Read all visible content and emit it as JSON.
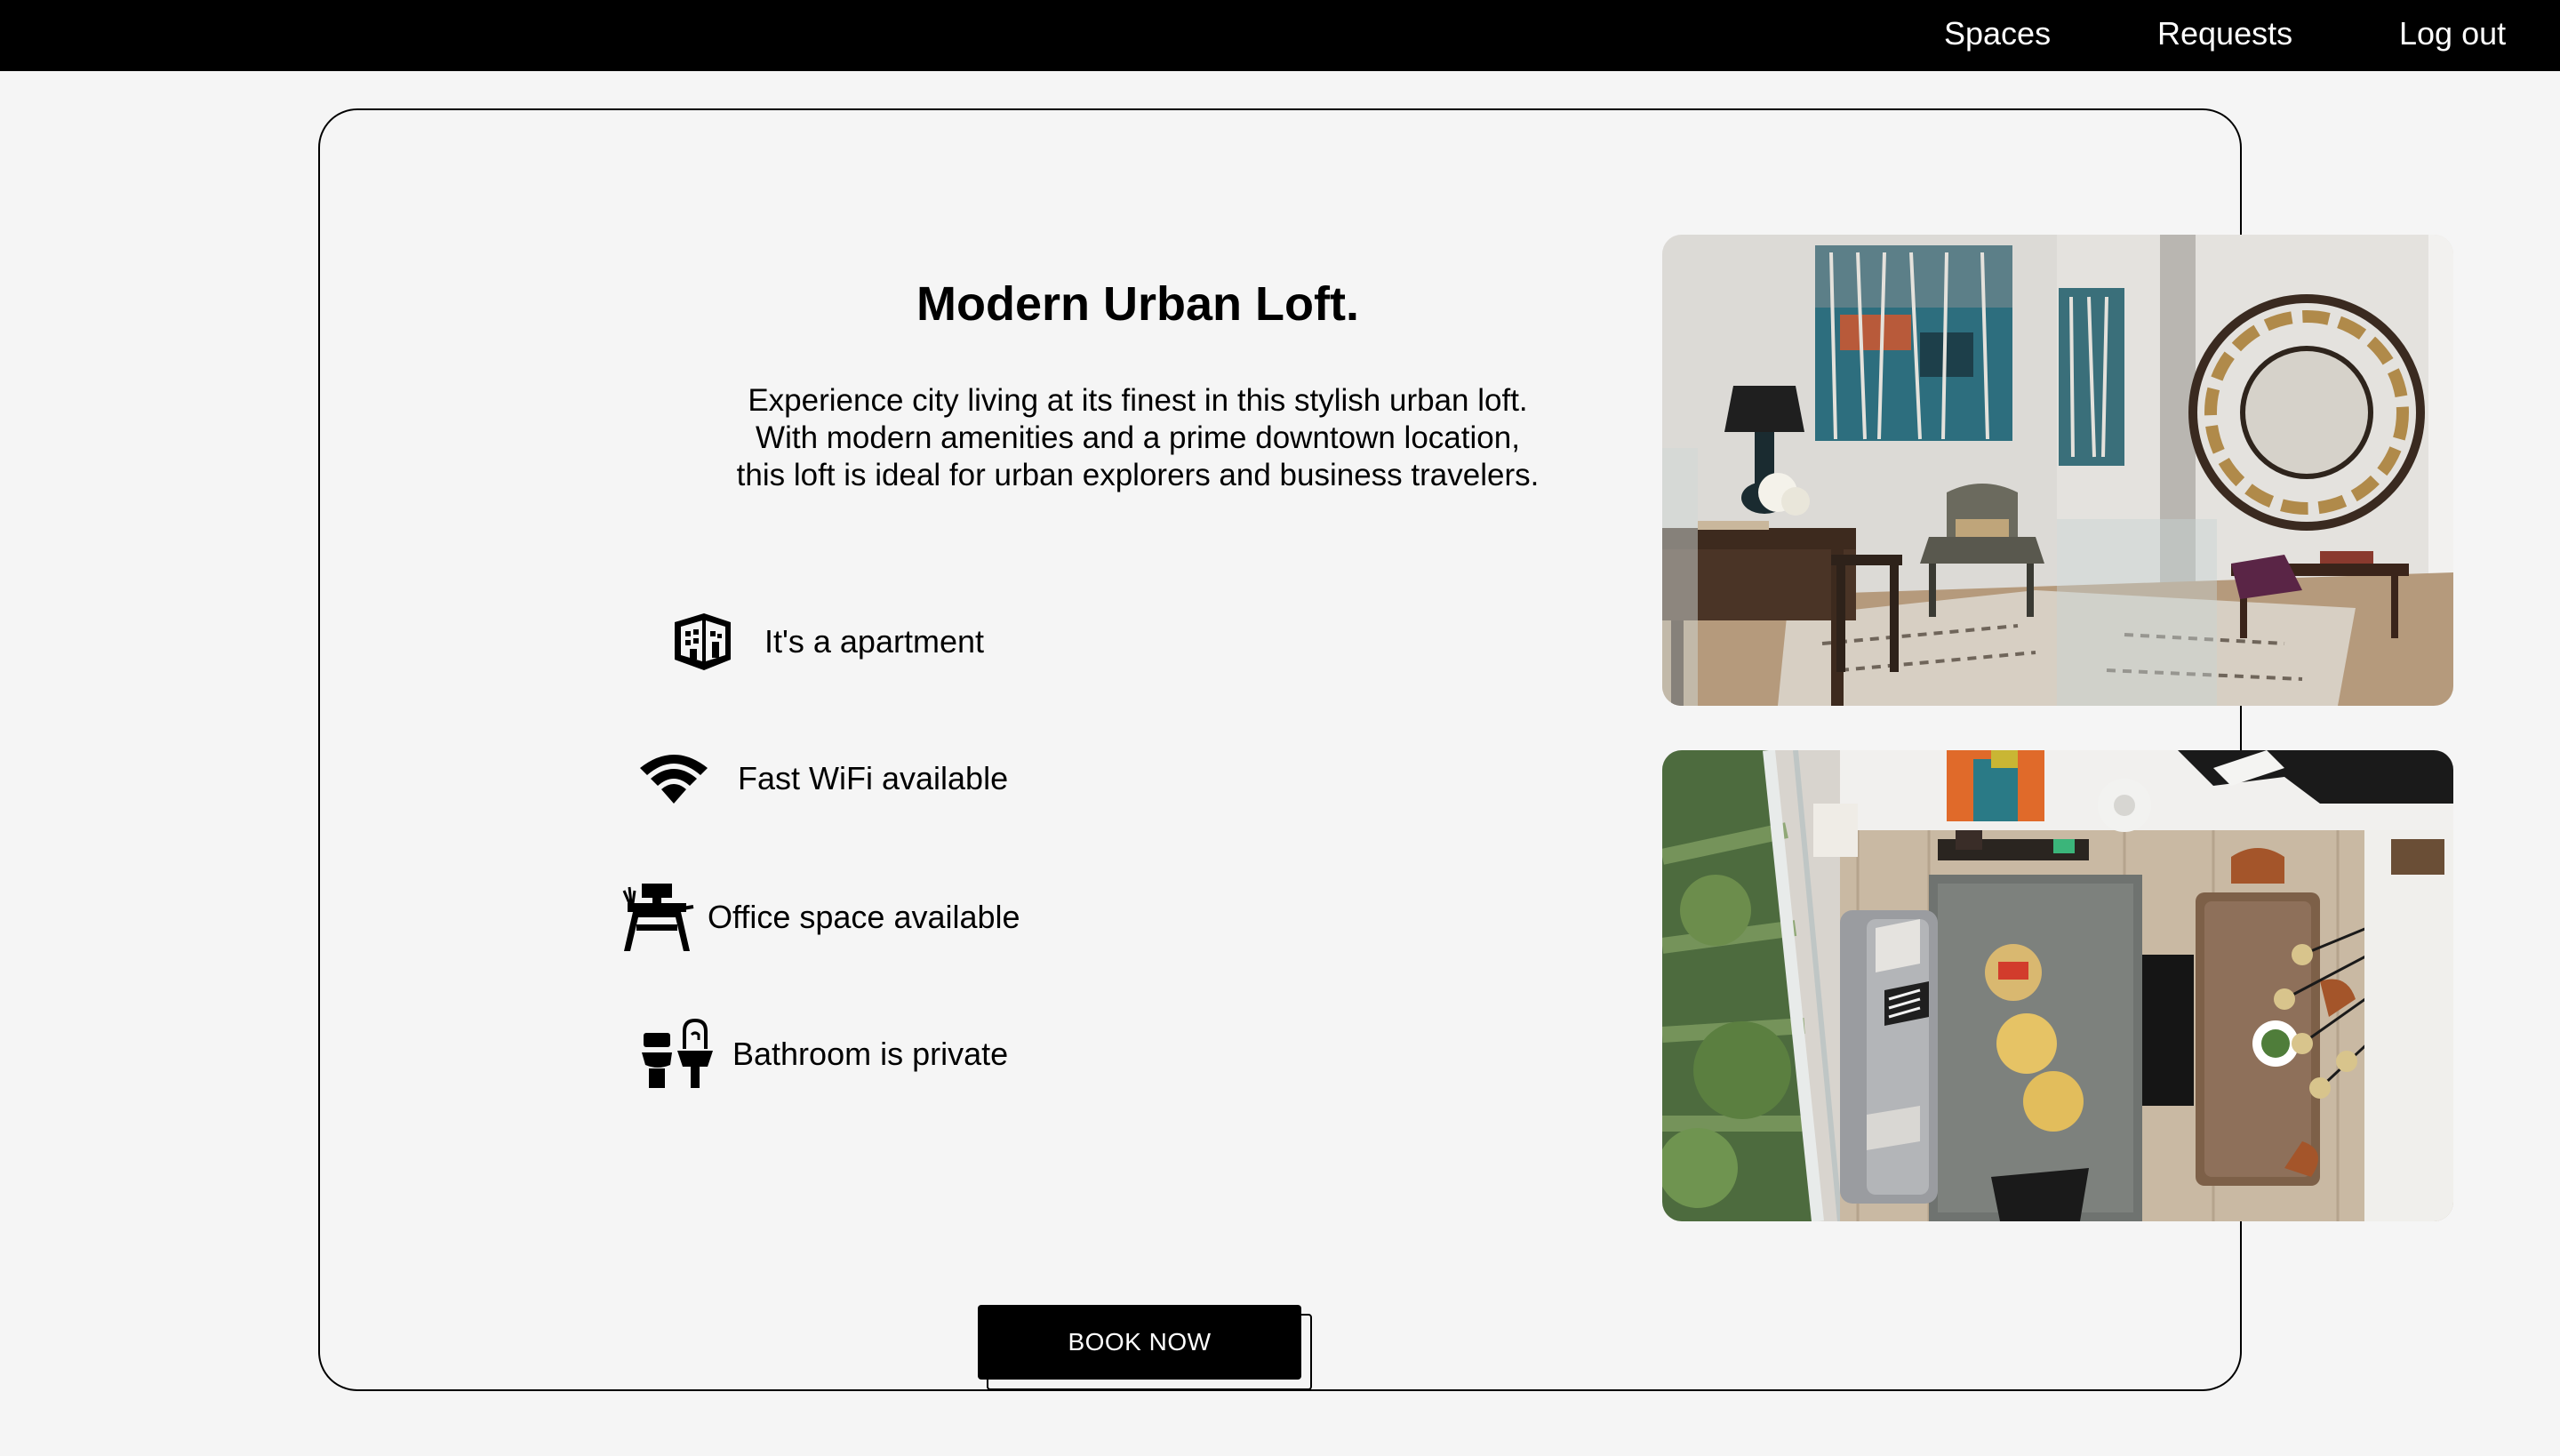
{
  "nav": {
    "links": [
      "Spaces",
      "Requests",
      "Log out"
    ]
  },
  "listing": {
    "title": "Modern Urban Loft.",
    "description": "Experience city living at its finest in this stylish urban loft. With modern amenities and a prime downtown location, this loft is ideal for urban explorers and business travelers.",
    "features": [
      {
        "icon": "building-icon",
        "label": "It's a apartment"
      },
      {
        "icon": "wifi-icon",
        "label": "Fast WiFi available"
      },
      {
        "icon": "office-desk-icon",
        "label": "Office space available"
      },
      {
        "icon": "bathroom-icon",
        "label": "Bathroom is private"
      }
    ],
    "book_label": "BOOK NOW",
    "photos": [
      "loft-office-photo",
      "loft-living-room-photo"
    ]
  },
  "colors": {
    "topbar": "#000000",
    "background": "#f5f5f5",
    "button": "#000000",
    "button_text": "#ffffff"
  }
}
